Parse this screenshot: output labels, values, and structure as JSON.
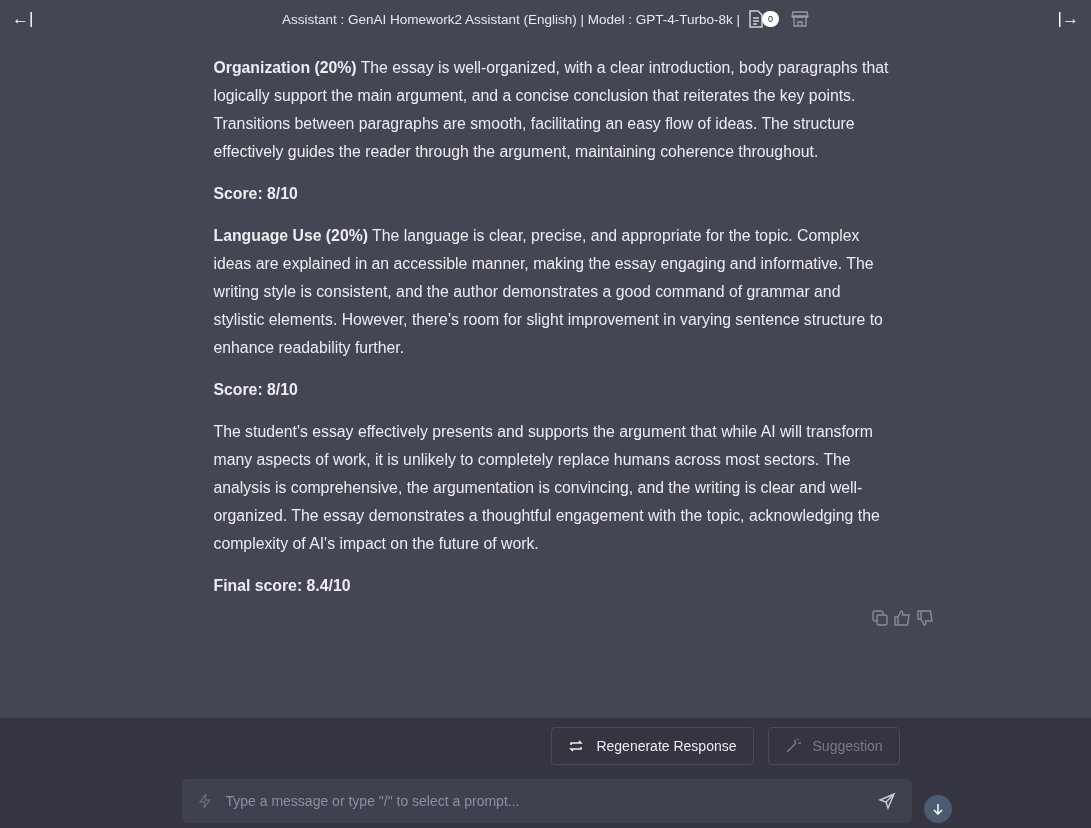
{
  "header": {
    "collapse_left": "←|",
    "title": "Assistant : GenAI Homework2 Assistant (English) | Model : GPT-4-Turbo-8k |",
    "doc_count": "0",
    "expand_right": "|→"
  },
  "message": [
    {
      "kind": "para",
      "text": "**Organization (20%)** The essay is well-organized, with a clear introduction, body paragraphs that logically support the main argument, and a concise conclusion that reiterates the key points. Transitions between paragraphs are smooth, facilitating an easy flow of ideas. The structure effectively guides the reader through the argument, maintaining coherence throughout."
    },
    {
      "kind": "score",
      "text": "Score: 8/10"
    },
    {
      "kind": "para",
      "text": "**Language Use (20%)** The language is clear, precise, and appropriate for the topic. Complex ideas are explained in an accessible manner, making the essay engaging and informative. The writing style is consistent, and the author demonstrates a good command of grammar and stylistic elements. However, there's room for slight improvement in varying sentence structure to enhance readability further."
    },
    {
      "kind": "score",
      "text": "Score: 8/10"
    },
    {
      "kind": "para",
      "text": "The student's essay effectively presents and supports the argument that while AI will transform many aspects of work, it is unlikely to completely replace humans across most sectors. The analysis is comprehensive, the argumentation is convincing, and the writing is clear and well-organized. The essay demonstrates a thoughtful engagement with the topic, acknowledging the complexity of AI's impact on the future of work."
    },
    {
      "kind": "score",
      "text": "Final score: 8.4/10"
    }
  ],
  "actions": [
    {
      "label": "Regenerate Response",
      "disabled": false
    },
    {
      "label": "Suggestion",
      "disabled": true
    }
  ],
  "composer": {
    "placeholder": "Type a message or type \"/\" to select a prompt..."
  }
}
